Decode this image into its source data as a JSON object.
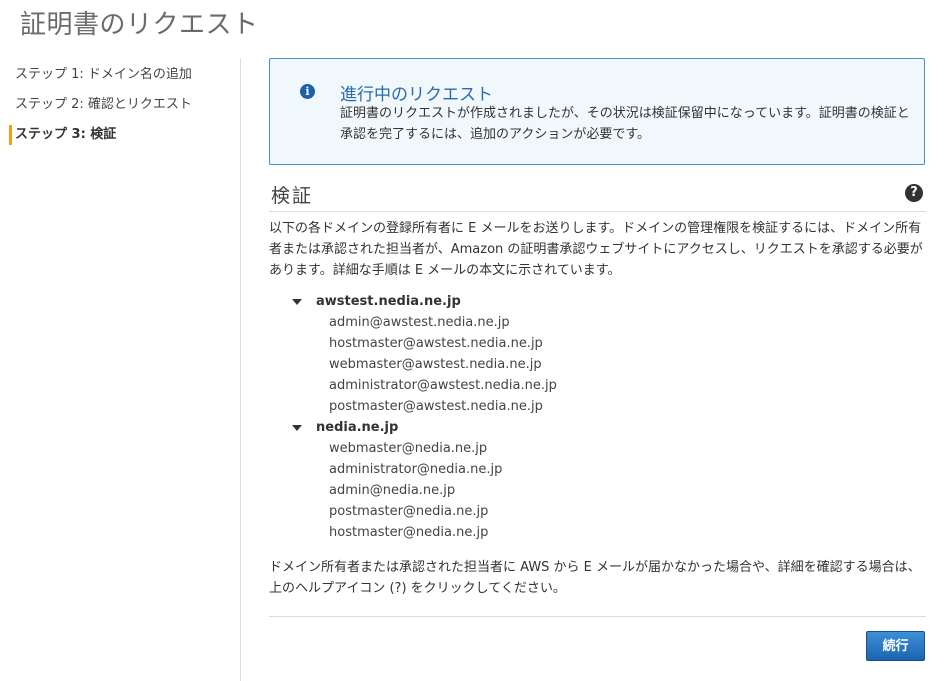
{
  "page": {
    "title": "証明書のリクエスト"
  },
  "steps": [
    {
      "label": "ステップ 1: ドメイン名の追加"
    },
    {
      "label": "ステップ 2: 確認とリクエスト"
    },
    {
      "label": "ステップ 3: 検証"
    }
  ],
  "active_step": 3,
  "info": {
    "icon": "info-icon",
    "title": "進行中のリクエスト",
    "text": "証明書のリクエストが作成されましたが、その状況は検証保留中になっています。証明書の検証と承認を完了するには、追加のアクションが必要です。"
  },
  "verification": {
    "title": "検証",
    "help_icon": "question-circle-icon",
    "description": "以下の各ドメインの登録所有者に E メールをお送りします。ドメインの管理権限を検証するには、ドメイン所有者または承認された担当者が、Amazon の証明書承認ウェブサイトにアクセスし、リクエストを承認する必要があります。詳細な手順は E メールの本文に示されています。",
    "domains": [
      {
        "name": "awstest.nedia.ne.jp",
        "emails": [
          "admin@awstest.nedia.ne.jp",
          "hostmaster@awstest.nedia.ne.jp",
          "webmaster@awstest.nedia.ne.jp",
          "administrator@awstest.nedia.ne.jp",
          "postmaster@awstest.nedia.ne.jp"
        ]
      },
      {
        "name": "nedia.ne.jp",
        "emails": [
          "webmaster@nedia.ne.jp",
          "administrator@nedia.ne.jp",
          "admin@nedia.ne.jp",
          "postmaster@nedia.ne.jp",
          "hostmaster@nedia.ne.jp"
        ]
      }
    ],
    "footer_note": "ドメイン所有者または承認された担当者に AWS から E メールが届かなかった場合や、詳細を確認する場合は、上のヘルプアイコン (?) をクリックしてください。"
  },
  "actions": {
    "continue_label": "続行"
  },
  "colors": {
    "accent": "#f29e1a",
    "info_border": "#4a90c4",
    "info_bg": "#f1f8fc",
    "primary_button": "#1b64b0"
  }
}
